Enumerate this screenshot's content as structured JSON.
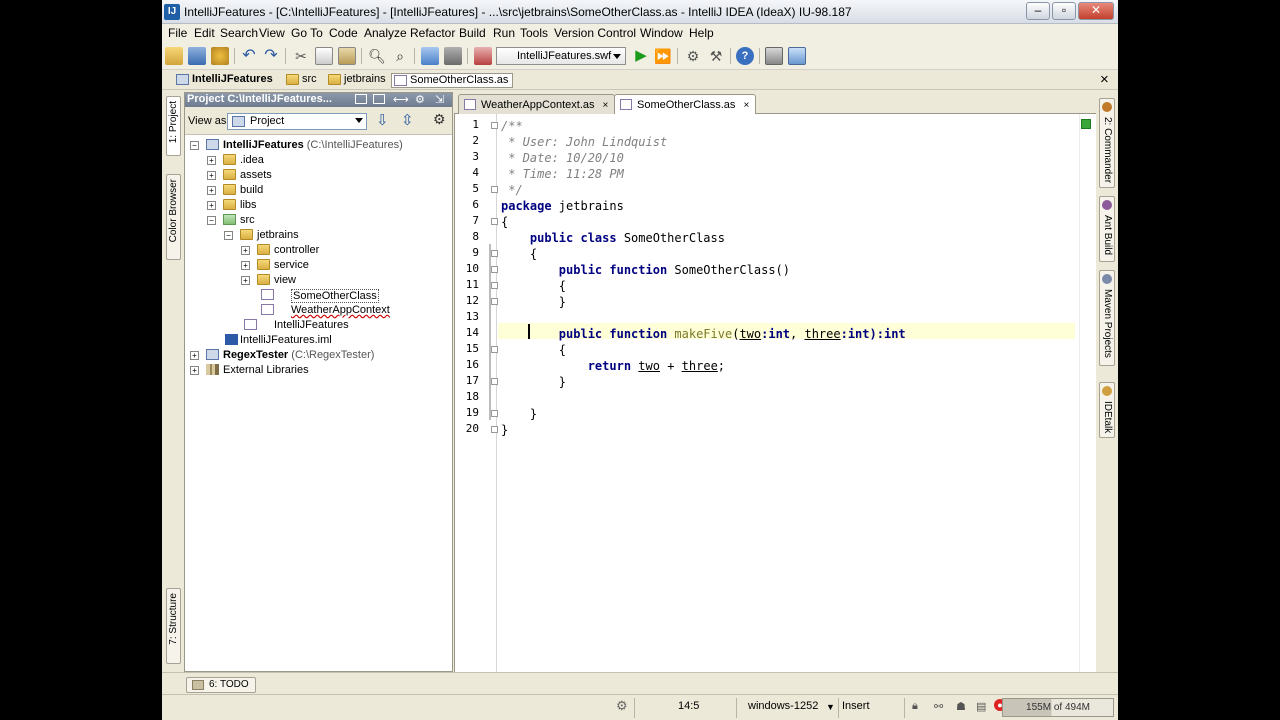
{
  "window": {
    "title": "IntelliJFeatures - [C:\\IntelliJFeatures] - [IntelliJFeatures] - ...\\src\\jetbrains\\SomeOtherClass.as - IntelliJ IDEA (IdeaX) IU-98.187",
    "app_icon": "IJ"
  },
  "menubar": [
    "File",
    "Edit",
    "Search",
    "View",
    "Go To",
    "Code",
    "Analyze",
    "Refactor",
    "Build",
    "Run",
    "Tools",
    "Version Control",
    "Window",
    "Help"
  ],
  "toolbar": {
    "run_config": "IntelliJFeatures.swf",
    "icons": [
      "open-icon",
      "save-icon",
      "sync-icon",
      "undo-icon",
      "redo-icon",
      "cut-icon",
      "copy-icon",
      "paste-icon",
      "find-icon",
      "replace-icon",
      "back-icon",
      "forward-icon",
      "build-icon",
      "run-icon",
      "debug-icon",
      "settings-icon",
      "structure-icon",
      "help-icon",
      "plugin-icon",
      "tasks-icon"
    ]
  },
  "navbar": {
    "crumbs": [
      "IntelliJFeatures",
      "src",
      "jetbrains",
      "SomeOtherClass.as"
    ],
    "close": "×"
  },
  "left_stripe": {
    "tabs": [
      "1: Project",
      "Color Browser",
      "7: Structure"
    ]
  },
  "project_panel": {
    "header": "Project C:\\IntelliJFeatures...",
    "view_as_label": "View as:",
    "view_as_value": "Project",
    "tree": [
      {
        "label": "IntelliJFeatures",
        "extra": " (C:\\IntelliJFeatures)",
        "depth": 0,
        "expander": "−",
        "icon": "module"
      },
      {
        "label": ".idea",
        "depth": 1,
        "expander": "+",
        "icon": "folder"
      },
      {
        "label": "assets",
        "depth": 1,
        "expander": "+",
        "icon": "folder"
      },
      {
        "label": "build",
        "depth": 1,
        "expander": "+",
        "icon": "folder"
      },
      {
        "label": "libs",
        "depth": 1,
        "expander": "+",
        "icon": "folder"
      },
      {
        "label": "src",
        "depth": 1,
        "expander": "−",
        "icon": "srcfolder"
      },
      {
        "label": "jetbrains",
        "depth": 2,
        "expander": "−",
        "icon": "folder"
      },
      {
        "label": "controller",
        "depth": 3,
        "expander": "+",
        "icon": "folder"
      },
      {
        "label": "service",
        "depth": 3,
        "expander": "+",
        "icon": "folder"
      },
      {
        "label": "view",
        "depth": 3,
        "expander": "+",
        "icon": "folder"
      },
      {
        "label": "SomeOtherClass",
        "depth": 3,
        "expander": "",
        "icon": "asfile",
        "selected": true
      },
      {
        "label": "WeatherAppContext",
        "depth": 3,
        "expander": "",
        "icon": "asfile"
      },
      {
        "label": "IntelliJFeatures",
        "depth": 2,
        "expander": "",
        "icon": "asfile"
      },
      {
        "label": "IntelliJFeatures.iml",
        "depth": 1,
        "expander": "",
        "icon": "iml"
      },
      {
        "label": "RegexTester",
        "extra": " (C:\\RegexTester)",
        "depth": 0,
        "expander": "+",
        "icon": "module"
      },
      {
        "label": "External Libraries",
        "depth": 0,
        "expander": "+",
        "icon": "lib"
      }
    ]
  },
  "editor": {
    "tabs": [
      {
        "label": "WeatherAppContext.as",
        "active": false
      },
      {
        "label": "SomeOtherClass.as",
        "active": true
      }
    ],
    "tab_close": "×",
    "line_numbers": [
      "1",
      "2",
      "3",
      "4",
      "5",
      "6",
      "7",
      "8",
      "9",
      "10",
      "11",
      "12",
      "13",
      "14",
      "15",
      "16",
      "17",
      "18",
      "19",
      "20"
    ],
    "lines": {
      "l1": "/**",
      "l2": " * User: John Lindquist",
      "l3": " * Date: 10/20/10",
      "l4": " * Time: 11:28 PM",
      "l5": " */",
      "l6_kw": "package",
      "l6_rest": " jetbrains",
      "l7": "{",
      "l8_kw": "public class",
      "l8_rest": " SomeOtherClass",
      "l9": "{",
      "l10_kw": "public function",
      "l10_rest": " SomeOtherClass()",
      "l11": "{",
      "l12": "}",
      "l14_kw": "public function",
      "l14_fn": " makeFive",
      "l14_p1": "two",
      "l14_t1": ":int",
      "l14_sep": ", ",
      "l14_p2": "three",
      "l14_t2": ":int",
      "l14_ret": "):int",
      "l15": "{",
      "l16_kw": "return",
      "l16_a": "two",
      "l16_op": " + ",
      "l16_b": "three",
      "l16_end": ";",
      "l17": "}",
      "l19": "}",
      "l20": "}"
    }
  },
  "right_stripe": {
    "tabs": [
      "2: Commander",
      "Ant Build",
      "Maven Projects",
      "IDEtalk"
    ]
  },
  "bottom": {
    "todo": "6: TODO"
  },
  "status": {
    "position": "14:5",
    "encoding": "windows-1252",
    "mode": "Insert",
    "memory": "155M of 494M"
  }
}
